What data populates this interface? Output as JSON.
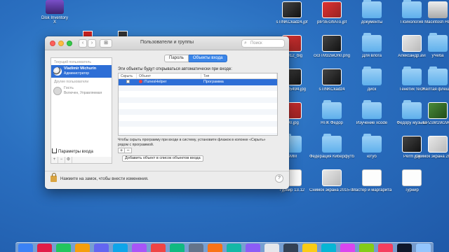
{
  "desktop": {
    "top_left_icon": "Disk Inventory X",
    "icons": [
      {
        "label": "sTINKCkadz4.jpf",
        "kind": "imgfile dark"
      },
      {
        "label": "pIP3EGhATo.jpf",
        "kind": "imgfile red"
      },
      {
        "label": "документы",
        "kind": "folder"
      },
      {
        "label": "Психология",
        "kind": "folder"
      },
      {
        "label": "Macintosh HD",
        "kind": "drive"
      },
      {
        "label": "er2012_big",
        "kind": "imgfile red"
      },
      {
        "label": "cx3TM32wOn0.png",
        "kind": "imgfile dark"
      },
      {
        "label": "Для влога",
        "kind": "folder"
      },
      {
        "label": "Александр.avi",
        "kind": "imgfile"
      },
      {
        "label": "уЧеба",
        "kind": "folder"
      },
      {
        "label": "471T85494.jpg",
        "kind": "imgfile dark"
      },
      {
        "label": "sTINKCkadz4",
        "kind": "imgfile dark"
      },
      {
        "label": "диск",
        "kind": "folder"
      },
      {
        "label": "Генетик тест",
        "kind": "folder"
      },
      {
        "label": "Желтая флешка",
        "kind": "folder"
      },
      {
        "label": "500.jpg",
        "kind": "imgfile red"
      },
      {
        "label": "НПК Федор",
        "kind": "folder"
      },
      {
        "label": "Изучение xcode",
        "kind": "folder"
      },
      {
        "label": "Федору музыка",
        "kind": "folder"
      },
      {
        "label": "EPZsM1W2vKc",
        "kind": "imgfile green"
      },
      {
        "label": "SMM",
        "kind": "folder"
      },
      {
        "label": "Федерация Киберфутбола",
        "kind": "folder"
      },
      {
        "label": "ютуб",
        "kind": "folder"
      },
      {
        "label": "Perm.jpg",
        "kind": "imgfile dark"
      },
      {
        "label": "Снимок экрана 2015-0....17.32.56",
        "kind": "imgfile"
      },
      {
        "label": "Турнир 13.12",
        "kind": "doc"
      },
      {
        "label": "Снимок экрана 2015-0....14.16.54",
        "kind": "imgfile"
      },
      {
        "label": "Мастер и маргарита",
        "kind": "doc"
      },
      {
        "label": "Турнир",
        "kind": "doc"
      }
    ]
  },
  "window": {
    "title": "Пользователи и группы",
    "search_placeholder": "Поиск",
    "nav_back": "‹",
    "nav_fwd": "›",
    "grid": "⊞"
  },
  "sidebar": {
    "current_user_header": "Текущий пользователь",
    "current_user": {
      "name": "Vladimir Michurin",
      "role": "Администратор"
    },
    "other_users_header": "Другие пользователи",
    "guest": {
      "name": "Гость",
      "role": "Включен, Управляемая"
    },
    "login_options": "Параметры входа",
    "controls": [
      "+",
      "−",
      "⚙"
    ]
  },
  "tabs": [
    {
      "label": "Пароль",
      "active": false
    },
    {
      "label": "Объекты входа",
      "active": true
    }
  ],
  "login_items": {
    "intro": "Эти объекты будут открываться автоматически при входе:",
    "columns": [
      "Скрыть",
      "Объект",
      "Тип"
    ],
    "rows": [
      {
        "hide": false,
        "item": "iTunesHelper",
        "type": "Программа",
        "selected": true
      }
    ],
    "hint": "Чтобы скрыть программу при входе в систему, установите флажок в колонке «Скрыть» рядом с программой.",
    "add_button": "Добавить объект в список объектов входа",
    "plus": "+",
    "minus": "−"
  },
  "footer": {
    "lock_text": "Нажмите на замок, чтобы внести изменения.",
    "help": "?"
  },
  "colors": {
    "accent": "#2d6ed6",
    "desktop": "#2a6fc0"
  }
}
